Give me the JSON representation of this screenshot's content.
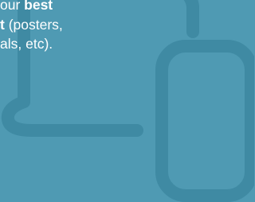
{
  "colors": {
    "background": "#4f9ab3",
    "icon_stroke": "#3f8aa3",
    "text": "#ffffff"
  },
  "icons": [
    "laptop-icon",
    "phone-icon"
  ],
  "text": {
    "line1_prefix": "our ",
    "line1_bold": "best",
    "line2_bold": "t",
    "line2_rest": " (posters,",
    "line3": "als, etc)."
  }
}
